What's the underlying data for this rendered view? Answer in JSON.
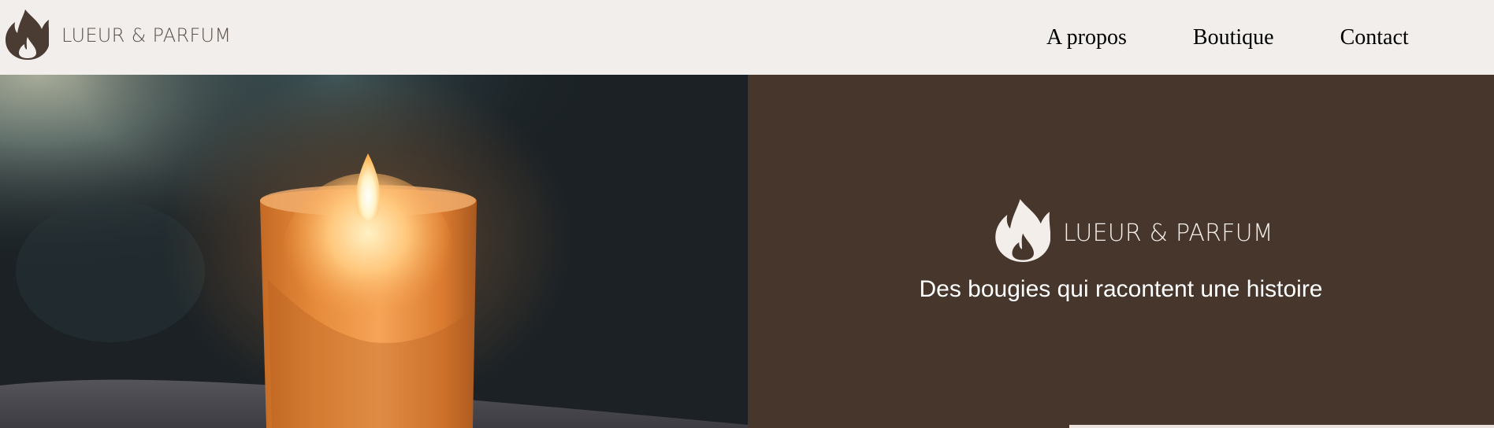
{
  "header": {
    "brand_name": "LUEUR & PARFUM",
    "brand_icon": "flame-icon",
    "nav": [
      {
        "label": "A propos"
      },
      {
        "label": "Boutique"
      },
      {
        "label": "Contact"
      }
    ]
  },
  "hero": {
    "image_icon": "candle-photo",
    "logo_name": "LUEUR & PARFUM",
    "logo_icon": "flame-icon",
    "tagline": "Des bougies qui racontent une histoire"
  },
  "colors": {
    "header_bg": "#f2eeeb",
    "brand_brown": "#4a3b33",
    "panel_bg": "#46362c",
    "panel_text": "#ffffff"
  }
}
